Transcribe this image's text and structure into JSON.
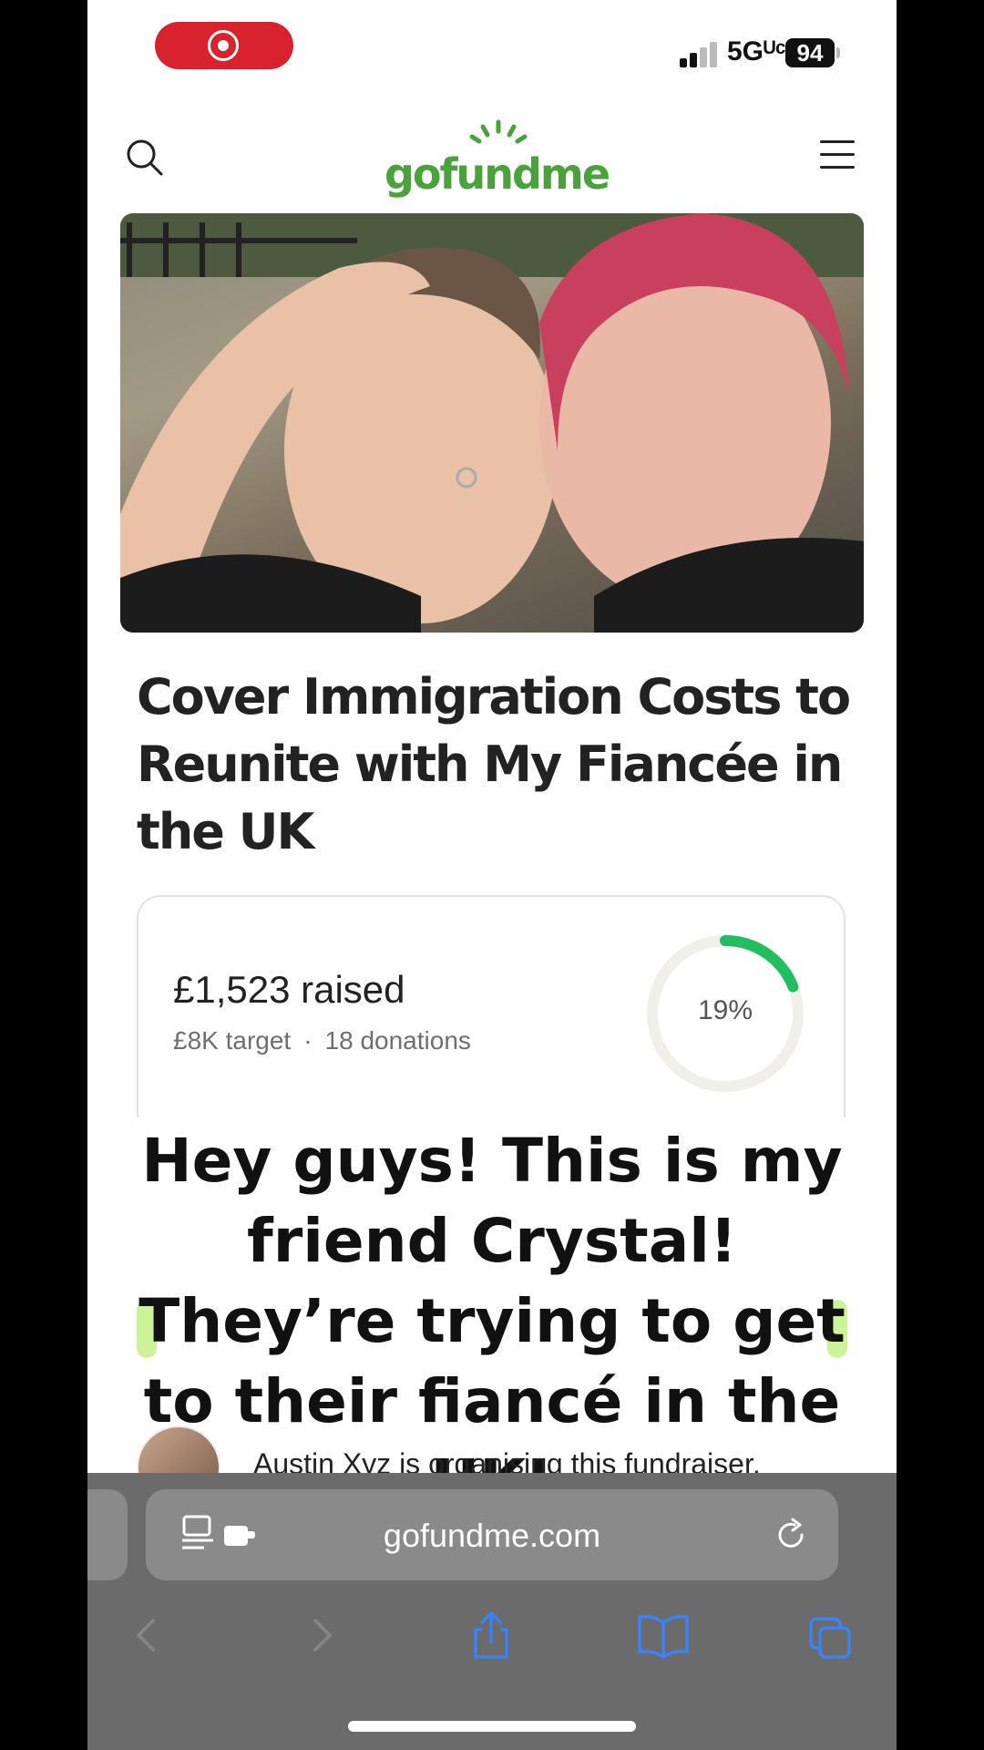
{
  "status": {
    "network": "5Gᵁᶜ",
    "battery": "94"
  },
  "site": {
    "logo_text": "gofundme",
    "brand_color": "#4aa23a"
  },
  "campaign": {
    "title": "Cover Immigration Costs to Reunite with My Fiancée in the UK",
    "raised": "£1,523 raised",
    "target": "£8K target",
    "separator": "·",
    "donations": "18 donations",
    "progress_label": "19%",
    "progress_fraction": 0.19,
    "progress_color": "#1fbf5f",
    "organiser_text": "Austin Xyz is organising this fundraiser."
  },
  "caption": {
    "text": "Hey guys! This is my friend Crystal! They’re trying to get to their fiancé in the UK!"
  },
  "browser": {
    "url": "gofundme.com",
    "icons": [
      "reader-icon",
      "extension-icon",
      "reload-icon",
      "back-icon",
      "forward-icon",
      "share-icon",
      "bookmarks-icon",
      "tabs-icon"
    ],
    "accent_color": "#3b82f6"
  }
}
